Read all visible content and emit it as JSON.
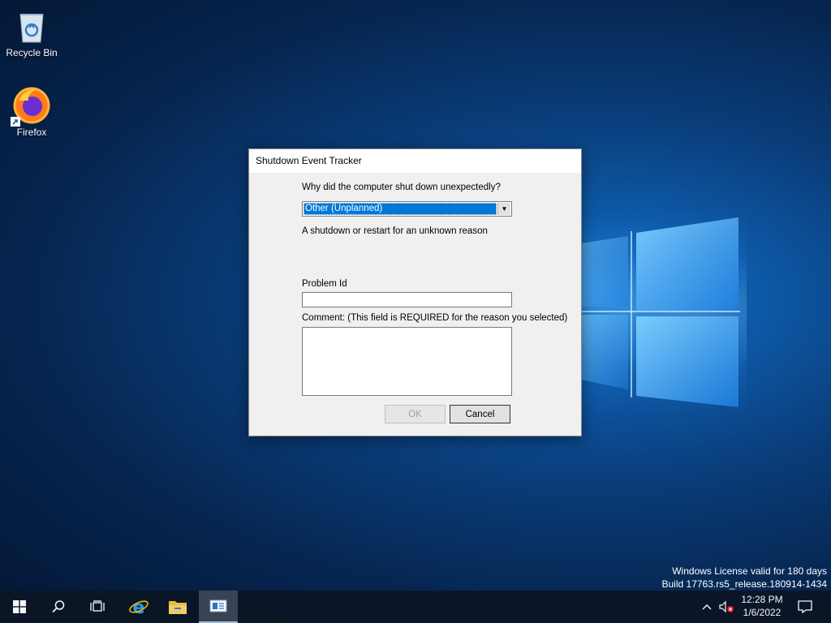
{
  "desktop": {
    "icons": [
      {
        "label": "Recycle Bin",
        "icon": "recycle-bin-icon"
      },
      {
        "label": "Firefox",
        "icon": "firefox-icon"
      }
    ],
    "watermark": {
      "line1": "Windows License valid for 180 days",
      "line2": "Build 17763.rs5_release.180914-1434"
    }
  },
  "dialog": {
    "title": "Shutdown Event Tracker",
    "question": "Why did the computer shut down unexpectedly?",
    "reason_selected": "Other (Unplanned)",
    "reason_description": "A shutdown or restart for an unknown reason",
    "problem_id_label": "Problem Id",
    "problem_id_value": "",
    "comment_label": "Comment: (This field is REQUIRED for the reason you selected)",
    "comment_value": "",
    "ok_label": "OK",
    "cancel_label": "Cancel"
  },
  "taskbar": {
    "items": [
      {
        "icon": "windows-start-icon"
      },
      {
        "icon": "search-icon"
      },
      {
        "icon": "task-view-icon"
      },
      {
        "icon": "internet-explorer-icon"
      },
      {
        "icon": "file-explorer-icon"
      },
      {
        "icon": "shutdown-tracker-icon"
      }
    ],
    "tray": {
      "time": "12:28 PM",
      "date": "1/6/2022"
    }
  },
  "colors": {
    "selection": "#0078d7",
    "dialog_bg": "#f0f0f0",
    "taskbar_bg": "#0b1526"
  }
}
